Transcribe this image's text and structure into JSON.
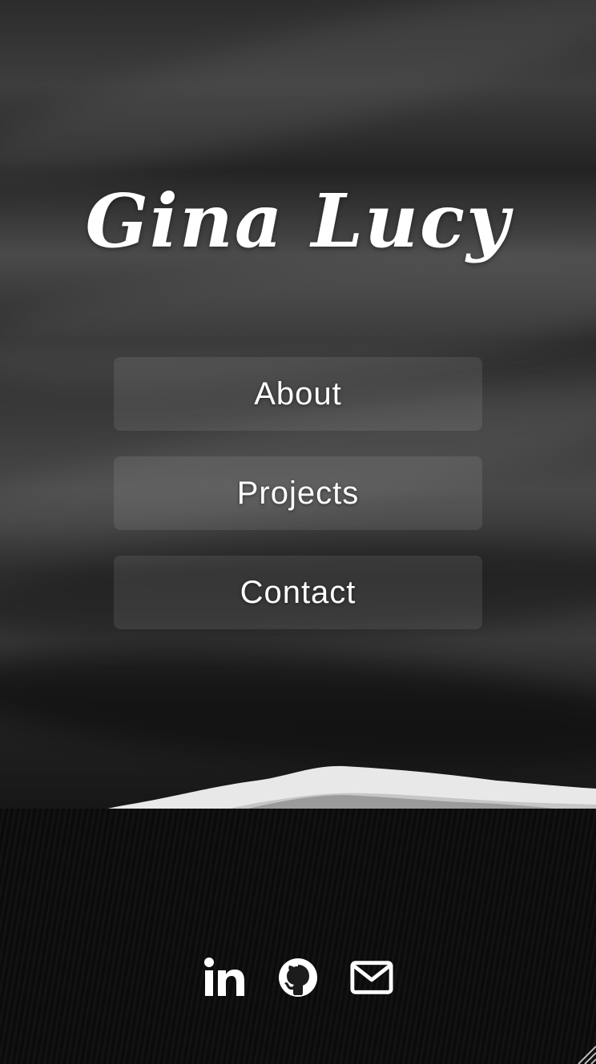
{
  "site": {
    "title": "Gina Lucy"
  },
  "nav": {
    "items": [
      {
        "label": "About"
      },
      {
        "label": "Projects"
      },
      {
        "label": "Contact"
      }
    ]
  },
  "social": {
    "icons": [
      "linkedin-icon",
      "github-icon",
      "envelope-icon"
    ]
  },
  "colors": {
    "text": "#ffffff",
    "button_bg": "rgba(255,255,255,0.09)",
    "background": "#2a2a2a",
    "sand": "#0b0b0b"
  }
}
